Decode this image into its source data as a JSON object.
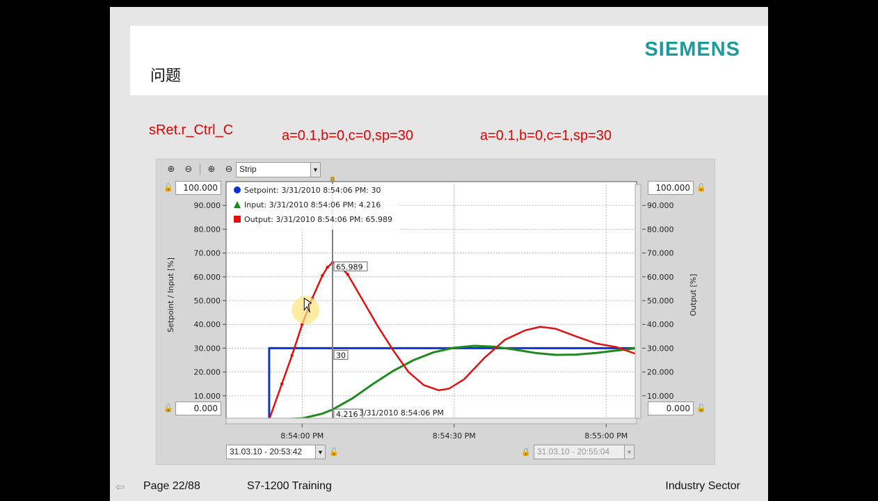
{
  "slide": {
    "brand": "SIEMENS",
    "title": "问题",
    "note_left": "sRet.r_Ctrl_C",
    "note_mid": "a=0.1,b=0,c=0,sp=30",
    "note_right": "a=0.1,b=0,c=1,sp=30",
    "footer": {
      "page": "Page 22/88",
      "course": "S7-1200 Training",
      "sector": "Industry Sector"
    }
  },
  "trend": {
    "mode_select": "Strip",
    "left_max": "100.000",
    "left_min": "0.000",
    "right_max": "100.000",
    "right_min": "0.000",
    "start_time": "31.03.10 - 20:53:42",
    "end_time": "31.03.10 - 20:55:04",
    "cursor_time_label": "3/31/2010 8:54:06 PM",
    "legend": [
      {
        "label": "Setpoint:",
        "value": "3/31/2010 8:54:06 PM: 30",
        "color": "#1030d0",
        "shape": "circle"
      },
      {
        "label": "Input:",
        "value": "3/31/2010 8:54:06 PM: 4.216",
        "color": "#1e8a1e",
        "shape": "triangle"
      },
      {
        "label": "Output:",
        "value": "3/31/2010 8:54:06 PM: 65.989",
        "color": "#e01010",
        "shape": "square"
      }
    ],
    "cursor_values": {
      "output": "65.989",
      "setpoint": "30",
      "input": "4.216"
    },
    "colors": {
      "setpoint": "#1030d0",
      "input": "#1e8a1e",
      "output": "#e01010",
      "cursor": "#808080"
    }
  },
  "chart_data": {
    "type": "line",
    "xlabel": "",
    "ylabel": "Setpoint / Input  [%]",
    "y2label": "Output  [%]",
    "ylim": [
      0,
      100
    ],
    "y2lim": [
      0,
      100
    ],
    "xlim_seconds": [
      -15,
      66
    ],
    "x_ticks": [
      {
        "t": 0,
        "label": "8:54:00 PM"
      },
      {
        "t": 30,
        "label": "8:54:30 PM"
      },
      {
        "t": 60,
        "label": "8:55:00 PM"
      }
    ],
    "y_ticks": [
      "10.000",
      "20.000",
      "30.000",
      "40.000",
      "50.000",
      "60.000",
      "70.000",
      "80.000",
      "90.000"
    ],
    "y_tick_values": [
      10,
      20,
      30,
      40,
      50,
      60,
      70,
      80,
      90
    ],
    "cursor_t": 6,
    "series": [
      {
        "name": "Setpoint",
        "axis": "left",
        "points": [
          [
            -15,
            0
          ],
          [
            -6.5,
            0
          ],
          [
            -6.5,
            30
          ],
          [
            66,
            30
          ]
        ]
      },
      {
        "name": "Input",
        "axis": "left",
        "points": [
          [
            -15,
            0
          ],
          [
            -6,
            0
          ],
          [
            0,
            0.5
          ],
          [
            4,
            2.5
          ],
          [
            6,
            4.2
          ],
          [
            10,
            9
          ],
          [
            14,
            15
          ],
          [
            18,
            20.5
          ],
          [
            22,
            25
          ],
          [
            26,
            28.3
          ],
          [
            30,
            30.2
          ],
          [
            34,
            31
          ],
          [
            38,
            30.6
          ],
          [
            42,
            29.4
          ],
          [
            46,
            28
          ],
          [
            50,
            27.2
          ],
          [
            54,
            27.3
          ],
          [
            58,
            28
          ],
          [
            62,
            29
          ],
          [
            66,
            30
          ]
        ]
      },
      {
        "name": "Output",
        "axis": "right",
        "points": [
          [
            -15,
            0
          ],
          [
            -6.5,
            0
          ],
          [
            -4,
            15
          ],
          [
            -2,
            27
          ],
          [
            0,
            40
          ],
          [
            2,
            51
          ],
          [
            4,
            60.5
          ],
          [
            5,
            64
          ],
          [
            6,
            66
          ],
          [
            7,
            65.5
          ],
          [
            9,
            61
          ],
          [
            12,
            50
          ],
          [
            15,
            39
          ],
          [
            18,
            29
          ],
          [
            21,
            20
          ],
          [
            24,
            14.5
          ],
          [
            27,
            12.3
          ],
          [
            29,
            13
          ],
          [
            32,
            17
          ],
          [
            36,
            26
          ],
          [
            40,
            33.5
          ],
          [
            44,
            37.5
          ],
          [
            47,
            39
          ],
          [
            50,
            38.2
          ],
          [
            54,
            35
          ],
          [
            58,
            32
          ],
          [
            62,
            30.5
          ],
          [
            66,
            27.5
          ]
        ]
      }
    ]
  }
}
